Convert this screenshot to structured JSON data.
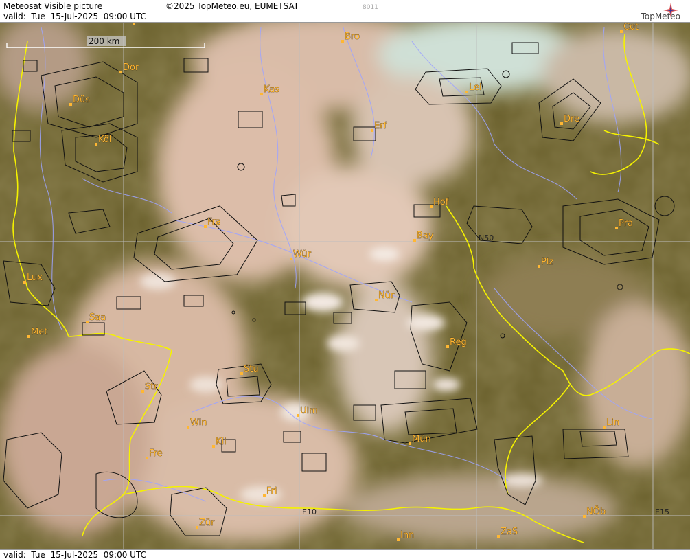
{
  "header": {
    "title": "Meteosat Visible picture",
    "valid": "valid:  Tue  15-Jul-2025  09:00 UTC",
    "copyright": "©2025 TopMeteo.eu, EUMETSAT",
    "code": "8011",
    "logo_text": "TopMeteo"
  },
  "footer": {
    "valid": "valid:  Tue  15-Jul-2025  09:00 UTC"
  },
  "map": {
    "scale_label": "200 km",
    "grid_labels": {
      "n50": "N50",
      "e10": "E10",
      "e15": "E15"
    },
    "cities": [
      {
        "name": "Mün",
        "id": "mun-top"
      },
      {
        "name": "Dor",
        "id": "dor"
      },
      {
        "name": "Düs",
        "id": "dus"
      },
      {
        "name": "Köl",
        "id": "kol"
      },
      {
        "name": "Kas",
        "id": "kas"
      },
      {
        "name": "Bro",
        "id": "bro"
      },
      {
        "name": "Lei",
        "id": "lei"
      },
      {
        "name": "Cot",
        "id": "cot"
      },
      {
        "name": "Dre",
        "id": "dre"
      },
      {
        "name": "Erf",
        "id": "erf"
      },
      {
        "name": "Hof",
        "id": "hof"
      },
      {
        "name": "Fra",
        "id": "fra"
      },
      {
        "name": "Bay",
        "id": "bay"
      },
      {
        "name": "Wür",
        "id": "wur"
      },
      {
        "name": "Pra",
        "id": "pra"
      },
      {
        "name": "Plz",
        "id": "plz"
      },
      {
        "name": "Lux",
        "id": "lux"
      },
      {
        "name": "Nür",
        "id": "nur"
      },
      {
        "name": "Saa",
        "id": "saa"
      },
      {
        "name": "Met",
        "id": "met"
      },
      {
        "name": "Reg",
        "id": "reg"
      },
      {
        "name": "Stu",
        "id": "stu"
      },
      {
        "name": "Str",
        "id": "str"
      },
      {
        "name": "Ulm",
        "id": "ulm"
      },
      {
        "name": "Win",
        "id": "win"
      },
      {
        "name": "Kli",
        "id": "kli"
      },
      {
        "name": "Mün",
        "id": "mun"
      },
      {
        "name": "Lin",
        "id": "lin"
      },
      {
        "name": "Fre",
        "id": "fre"
      },
      {
        "name": "Fri",
        "id": "fri"
      },
      {
        "name": "Zür",
        "id": "zur"
      },
      {
        "name": "Inn",
        "id": "inn"
      },
      {
        "name": "ZaS",
        "id": "zas"
      },
      {
        "name": "NÖb",
        "id": "nob"
      }
    ],
    "colors": {
      "land_dark": "#56481f",
      "land": "#6f6530",
      "cloud": "#d8b9a4",
      "cloud_bright": "#f0e4dc",
      "border": "#ffff00",
      "river": "#9aa0ff",
      "airspace": "#111111",
      "grid": "#b8b8b8",
      "city": "#ffb733"
    }
  }
}
